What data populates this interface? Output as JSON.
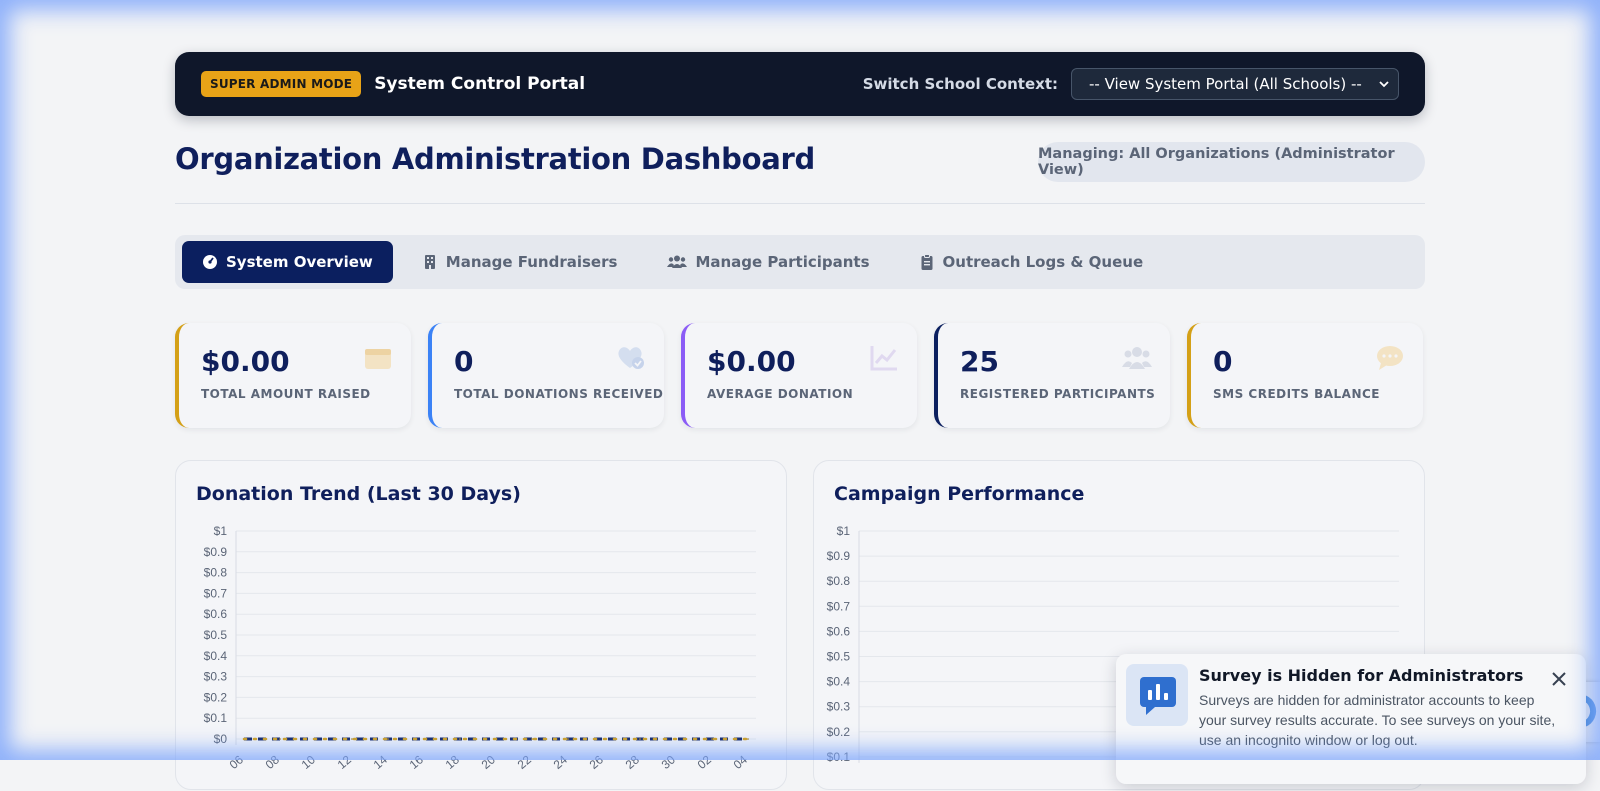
{
  "header": {
    "mode_badge": "SUPER ADMIN MODE",
    "portal_title": "System Control Portal",
    "switch_label": "Switch School Context:",
    "school_select": "-- View System Portal (All Schools) --"
  },
  "page": {
    "title": "Organization Administration Dashboard",
    "managing": "Managing: All Organizations (Administrator View)"
  },
  "tabs": [
    {
      "label": "System Overview",
      "icon": "dashboard-icon",
      "active": true
    },
    {
      "label": "Manage Fundraisers",
      "icon": "building-icon",
      "active": false
    },
    {
      "label": "Manage Participants",
      "icon": "users-icon",
      "active": false
    },
    {
      "label": "Outreach Logs & Queue",
      "icon": "clipboard-icon",
      "active": false
    }
  ],
  "stats": [
    {
      "value": "$0.00",
      "label": "TOTAL AMOUNT RAISED",
      "accent": "#d4a017",
      "icon": "wallet-icon"
    },
    {
      "value": "0",
      "label": "TOTAL DONATIONS RECEIVED",
      "accent": "#3b82f6",
      "icon": "heart-check-icon"
    },
    {
      "value": "$0.00",
      "label": "AVERAGE DONATION",
      "accent": "#8b5cf6",
      "icon": "chart-line-icon"
    },
    {
      "value": "25",
      "label": "REGISTERED PARTICIPANTS",
      "accent": "#0b1f5f",
      "icon": "users-icon"
    },
    {
      "value": "0",
      "label": "SMS CREDITS BALANCE",
      "accent": "#d4a017",
      "icon": "sms-icon"
    }
  ],
  "colors": {
    "navy": "#0b1f5f",
    "gold": "#d4a017",
    "header_bg": "#0f172a"
  },
  "panels": {
    "trend_title": "Donation Trend (Last 30 Days)",
    "campaign_title": "Campaign Performance"
  },
  "chart_data": [
    {
      "type": "line",
      "title": "Donation Trend (Last 30 Days)",
      "y_ticks": [
        "$1",
        "$0.9",
        "$0.8",
        "$0.7",
        "$0.6",
        "$0.5",
        "$0.4",
        "$0.3",
        "$0.2",
        "$0.1",
        "$0"
      ],
      "ylim": [
        0,
        1
      ],
      "x": [
        "06",
        "08",
        "10",
        "12",
        "14",
        "16",
        "18",
        "20",
        "22",
        "24",
        "26",
        "28",
        "30",
        "02",
        "04"
      ],
      "series": [
        {
          "color": "#0b1f5f",
          "dash": "long",
          "values": [
            0,
            0,
            0,
            0,
            0,
            0,
            0,
            0,
            0,
            0,
            0,
            0,
            0,
            0,
            0
          ]
        },
        {
          "color": "#d4a017",
          "dash": "dot",
          "values": [
            0,
            0,
            0,
            0,
            0,
            0,
            0,
            0,
            0,
            0,
            0,
            0,
            0,
            0,
            0
          ]
        }
      ],
      "grid": true
    },
    {
      "type": "bar",
      "title": "Campaign Performance",
      "y_ticks": [
        "$1",
        "$0.9",
        "$0.8",
        "$0.7",
        "$0.6",
        "$0.5",
        "$0.4",
        "$0.3",
        "$0.2",
        "$0.1"
      ],
      "ylim": [
        0,
        1
      ],
      "categories": [],
      "values": [],
      "grid": true
    }
  ],
  "toast": {
    "title": "Survey is Hidden for Administrators",
    "text": "Surveys are hidden for administrator accounts to keep your survey results accurate. To see surveys on your site, use an incognito window or log out."
  }
}
